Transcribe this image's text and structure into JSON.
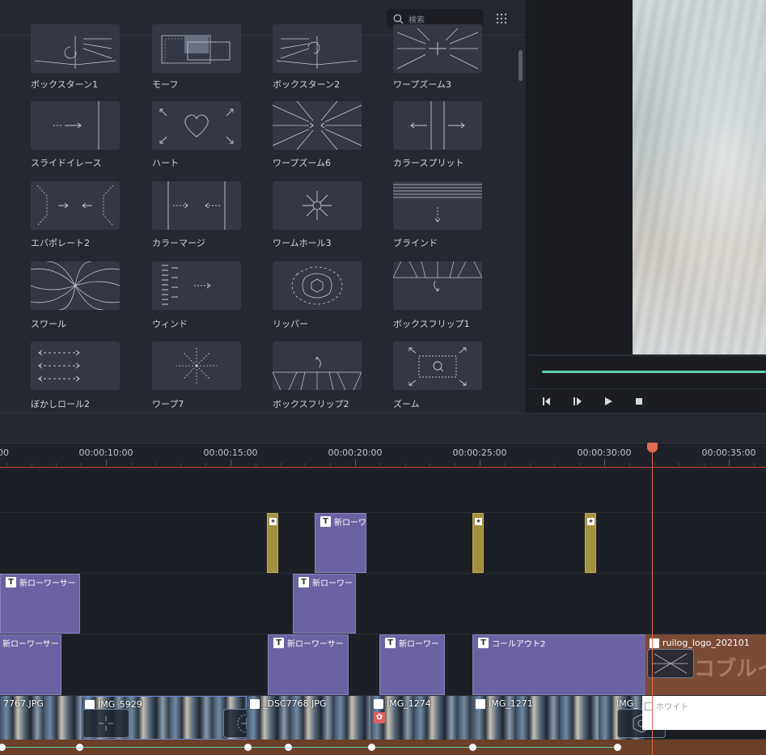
{
  "library": {
    "search_placeholder": "検索",
    "items": [
      {
        "label": "ボックスターン1",
        "icon": "box-turn-icon"
      },
      {
        "label": "モーフ",
        "icon": "morph-icon"
      },
      {
        "label": "ボックスターン2",
        "icon": "box-turn-icon"
      },
      {
        "label": "ワープズーム3",
        "icon": "warp-zoom-icon"
      },
      {
        "label": "スライドイレース",
        "icon": "slide-erase-icon"
      },
      {
        "label": "ハート",
        "icon": "heart-icon"
      },
      {
        "label": "ワープズーム6",
        "icon": "warp-zoom-icon"
      },
      {
        "label": "カラースプリット",
        "icon": "color-split-icon"
      },
      {
        "label": "エバポレート2",
        "icon": "evaporate-icon"
      },
      {
        "label": "カラーマージ",
        "icon": "color-merge-icon"
      },
      {
        "label": "ワームホール3",
        "icon": "wormhole-icon"
      },
      {
        "label": "ブラインド",
        "icon": "blind-icon"
      },
      {
        "label": "スワール",
        "icon": "swirl-icon"
      },
      {
        "label": "ウィンド",
        "icon": "wind-icon"
      },
      {
        "label": "リッパー",
        "icon": "ripper-icon"
      },
      {
        "label": "ボックスフリップ1",
        "icon": "box-flip-icon"
      },
      {
        "label": "ぼかしロール2",
        "icon": "blur-roll-icon"
      },
      {
        "label": "ワープ7",
        "icon": "warp-icon"
      },
      {
        "label": "ボックスフリップ2",
        "icon": "box-flip-icon"
      },
      {
        "label": "ズーム",
        "icon": "zoom-icon"
      }
    ]
  },
  "timeline": {
    "ruler_labels": [
      "00",
      "00:00:10:00",
      "00:00:15:00",
      "00:00:20:00",
      "00:00:25:00",
      "00:00:30:00",
      "00:00:35:00"
    ],
    "title_track_1": [
      "新ローワ"
    ],
    "title_track_2": [
      "新ローワーサー",
      "新ローワー"
    ],
    "title_track_3": [
      "新ローワーサー",
      "新ローワーサー",
      "新ローワー",
      "コールアウト2"
    ],
    "logo_clip": "ruilog_logo_202101",
    "logo_text": "コブルイ",
    "video_clips": [
      "7767.JPG",
      "IMG_5929",
      "_DSC7768.JPG",
      "IMG_1274",
      "IMG_1271",
      "IMG_"
    ],
    "white_clip": "ホワイト",
    "colors": {
      "accent": "#5fd3b3",
      "clip": "#6b63a1",
      "playhead": "#e56a4f",
      "marker": "#a4913f",
      "audio": "#6b3f28"
    }
  }
}
